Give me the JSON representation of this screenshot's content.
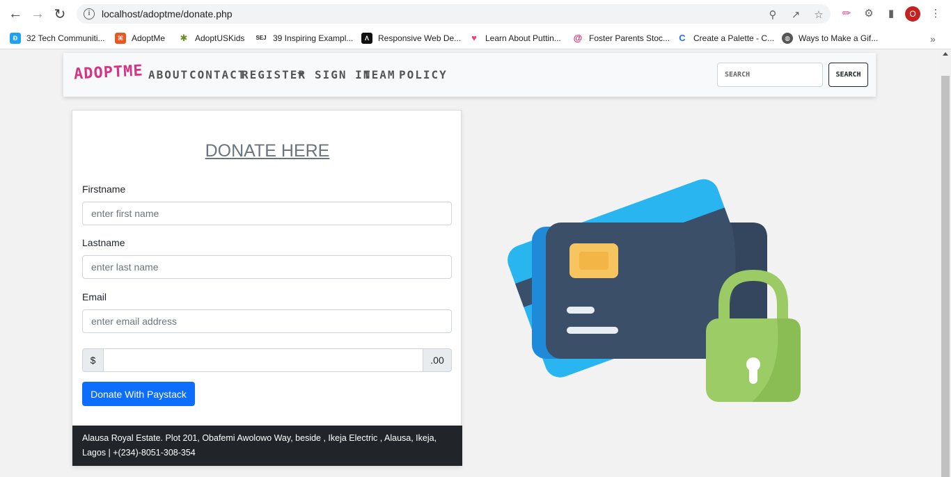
{
  "browser": {
    "url": "localhost/adoptme/donate.php",
    "profile_initial": "O"
  },
  "bookmarks": [
    {
      "label": "32 Tech Communiti...",
      "color": "#1da1f2",
      "glyph": "D"
    },
    {
      "label": "AdoptMe",
      "color": "#e8581f",
      "glyph": "⌘"
    },
    {
      "label": "AdoptUSKids",
      "color": "#6b8e23",
      "glyph": "✱"
    },
    {
      "label": "39 Inspiring Exampl...",
      "color": "#333333",
      "glyph": "SEJ"
    },
    {
      "label": "Responsive Web De...",
      "color": "#111111",
      "glyph": "A"
    },
    {
      "label": "Learn About Puttin...",
      "color": "#e8457a",
      "glyph": "♥"
    },
    {
      "label": "Foster Parents Stoc...",
      "color": "#d6246e",
      "glyph": "@"
    },
    {
      "label": "Create a Palette - C...",
      "color": "#1a73e8",
      "glyph": "C"
    },
    {
      "label": "Ways to Make a Gif...",
      "color": "#555555",
      "glyph": "◍"
    }
  ],
  "navbar": {
    "brand": "ADOPTME",
    "links": [
      "ABOUT",
      "CONTACT",
      "REGISTER",
      "SIGN IN",
      "TEAM",
      "POLICY"
    ],
    "search_placeholder": "SEARCH",
    "search_button": "SEARCH"
  },
  "form": {
    "title": "DONATE HERE",
    "firstname_label": "Firstname",
    "firstname_placeholder": "enter first name",
    "lastname_label": "Lastname",
    "lastname_placeholder": "enter last name",
    "email_label": "Email",
    "email_placeholder": "enter email address",
    "currency_prefix": "$",
    "currency_suffix": ".00",
    "submit_label": "Donate With Paystack"
  },
  "footer": {
    "address_line1": "Alausa Royal Estate. Plot 201, Obafemi Awolowo Way, beside , Ikeja Electric , Alausa, Ikeja,",
    "address_line2": "Lagos | +(234)-8051-308-354"
  }
}
